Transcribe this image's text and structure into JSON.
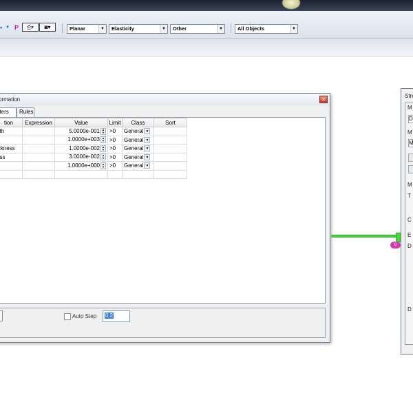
{
  "toolbar": {
    "icons": [
      "dropdown-arrow-icon",
      "p-icon",
      "printer-icon",
      "camera-icon"
    ],
    "p_glyph": "P",
    "combos": [
      {
        "value": "Planar"
      },
      {
        "value": "Elasticity"
      },
      {
        "value": "Other"
      },
      {
        "value": "All Objects"
      }
    ]
  },
  "dialog": {
    "title": "ormation",
    "close": "×",
    "tabs": [
      {
        "label": "eters",
        "active": true
      },
      {
        "label": "Rules",
        "active": false
      }
    ],
    "columns": [
      "tion",
      "Expression",
      "Value",
      "Limit",
      "Class",
      "Sort"
    ],
    "rows": [
      {
        "name": "gth",
        "expression": "",
        "value": "5.0000e-001",
        "limit": ">0",
        "class": "General"
      },
      {
        "name": "",
        "expression": "",
        "value": "1.0000e+003",
        "limit": ">0",
        "class": "General"
      },
      {
        "name": "ickness",
        "expression": "",
        "value": "1.0000e-002",
        "limit": ">0",
        "class": "General"
      },
      {
        "name": "ess",
        "expression": "",
        "value": "3.0000e-002",
        "limit": ">0",
        "class": "General"
      },
      {
        "name": "",
        "expression": "",
        "value": "1.0000e+000",
        "limit": ">0",
        "class": "General"
      },
      {
        "name": "",
        "expression": "",
        "value": "",
        "limit": "",
        "class": ""
      }
    ],
    "auto_step_label": "Auto Step",
    "step_value": "0.2"
  },
  "connector": {
    "node_label": "0"
  },
  "right_dialog": {
    "title": "Stre",
    "labels": [
      "M",
      "D",
      "M",
      "M",
      "T",
      "C",
      "E",
      "D",
      "D"
    ]
  }
}
